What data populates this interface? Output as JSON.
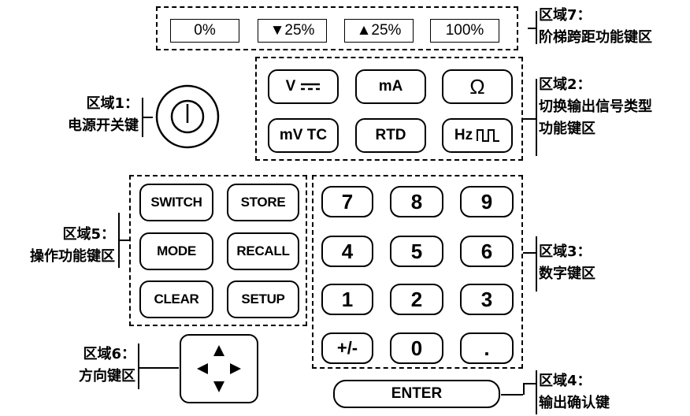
{
  "zone7": {
    "title": "区域7：",
    "desc": "阶梯跨距功能键区",
    "buttons": [
      "0%",
      "▼25%",
      "▲25%",
      "100%"
    ]
  },
  "zone1": {
    "title": "区域1：",
    "desc": "电源开关键"
  },
  "zone2": {
    "title": "区域2：",
    "desc1": "切换输出信号类型",
    "desc2": "功能键区",
    "buttons": {
      "v": "V",
      "ma": "mA",
      "ohm": "Ω",
      "mvtc": "mV TC",
      "rtd": "RTD",
      "hz": "Hz"
    }
  },
  "zone5": {
    "title": "区域5：",
    "desc": "操作功能键区",
    "buttons": {
      "switch": "SWITCH",
      "store": "STORE",
      "mode": "MODE",
      "recall": "RECALL",
      "clear": "CLEAR",
      "setup": "SETUP"
    }
  },
  "zone3": {
    "title": "区域3：",
    "desc": "数字键区",
    "keys": [
      "7",
      "8",
      "9",
      "4",
      "5",
      "6",
      "1",
      "2",
      "3",
      "+/-",
      "0",
      "."
    ]
  },
  "zone6": {
    "title": "区域6：",
    "desc": "方向键区"
  },
  "zone4": {
    "title": "区域4：",
    "desc": "输出确认键",
    "button": "ENTER"
  }
}
